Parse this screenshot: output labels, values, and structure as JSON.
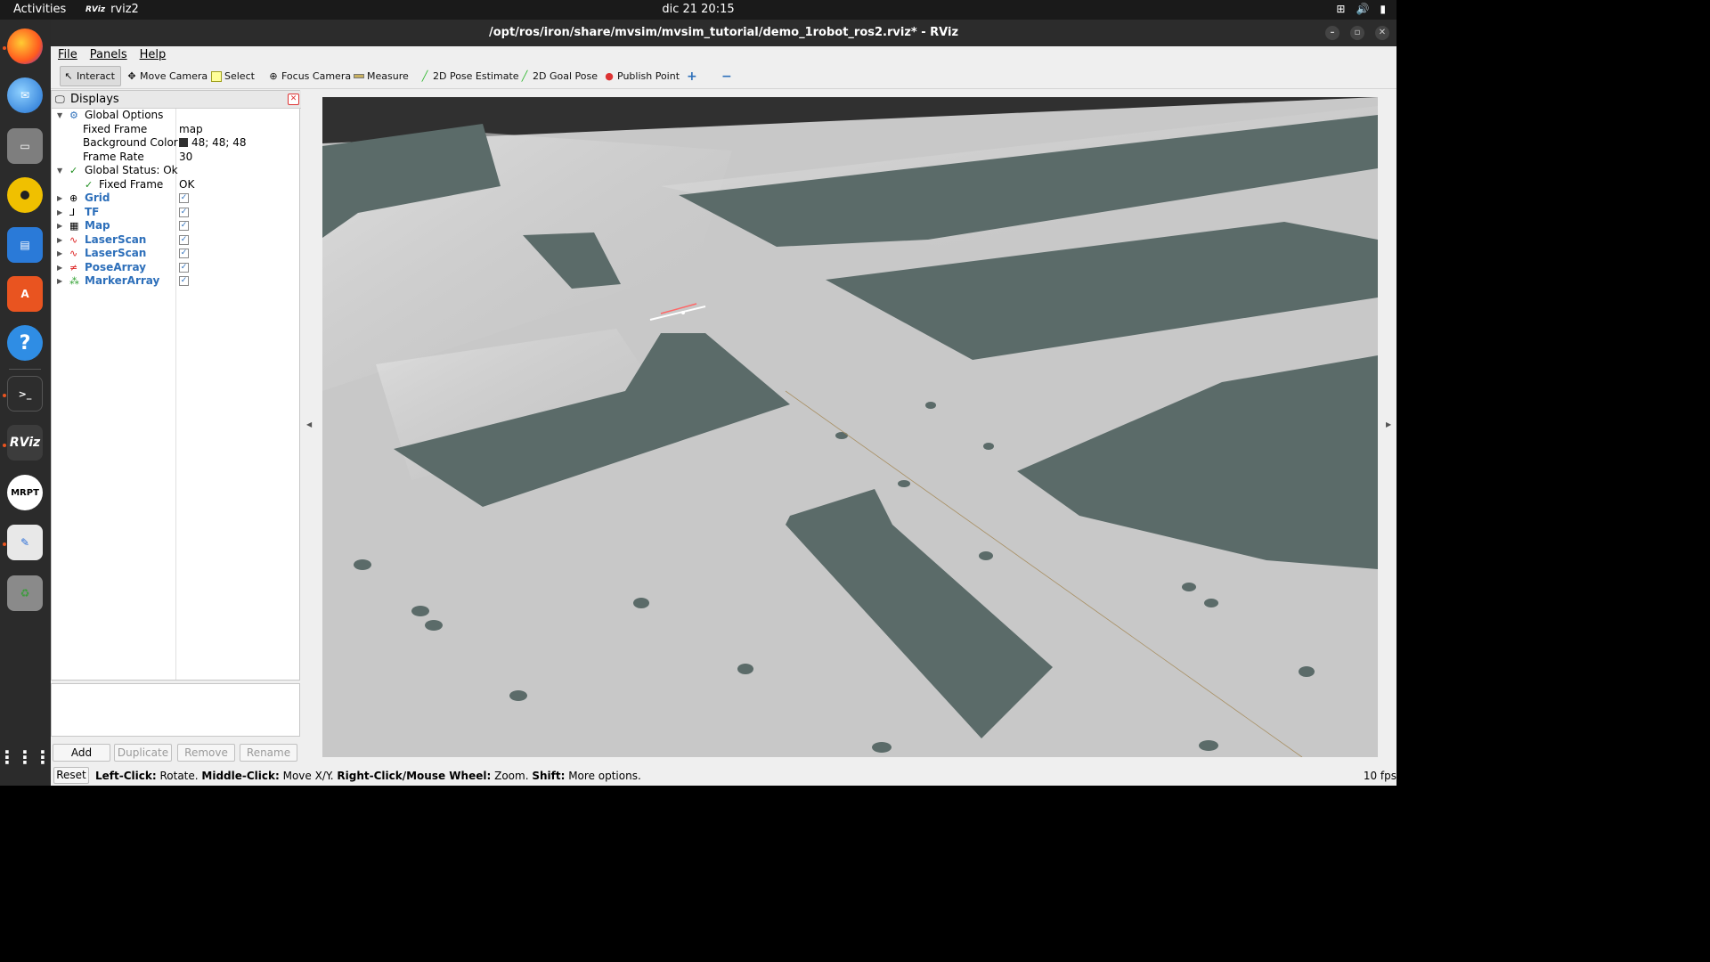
{
  "topbar": {
    "activities": "Activities",
    "app_name": "rviz2",
    "app_logo": "RViz",
    "clock": "dic 21  20:15",
    "tray_icons": [
      "network-icon",
      "volume-icon",
      "battery-icon"
    ]
  },
  "dock": {
    "items": [
      "firefox-icon",
      "thunderbird-icon",
      "files-icon",
      "rhythmbox-icon",
      "writer-icon",
      "app-center-icon",
      "help-icon",
      "terminal-icon",
      "rviz-icon",
      "mrpt-icon",
      "text-editor-icon",
      "trash-icon",
      "app-grid-icon"
    ],
    "rviz_label": "RViz",
    "mrpt_label": "MRPT"
  },
  "window": {
    "title": "/opt/ros/iron/share/mvsim/mvsim_tutorial/demo_1robot_ros2.rviz* - RViz"
  },
  "menu": [
    "File",
    "Panels",
    "Help"
  ],
  "toolbar": [
    {
      "label": "Interact",
      "icon": "cursor-icon",
      "active": true
    },
    {
      "label": "Move Camera",
      "icon": "move-camera-icon"
    },
    {
      "label": "Select",
      "icon": "select-icon"
    },
    {
      "label": "Focus Camera",
      "icon": "focus-camera-icon"
    },
    {
      "label": "Measure",
      "icon": "measure-icon"
    },
    {
      "label": "2D Pose Estimate",
      "icon": "pose-estimate-icon"
    },
    {
      "label": "2D Goal Pose",
      "icon": "goal-pose-icon"
    },
    {
      "label": "Publish Point",
      "icon": "publish-point-icon"
    }
  ],
  "displays": {
    "header": "Displays",
    "global_options": {
      "label": "Global Options",
      "fixed_frame_label": "Fixed Frame",
      "fixed_frame_value": "map",
      "background_color_label": "Background Color",
      "background_color_value": "48; 48; 48",
      "frame_rate_label": "Frame Rate",
      "frame_rate_value": "30"
    },
    "global_status": {
      "label": "Global Status: Ok",
      "fixed_frame_label": "Fixed Frame",
      "fixed_frame_value": "OK"
    },
    "items": [
      {
        "label": "Grid",
        "checked": true
      },
      {
        "label": "TF",
        "checked": true
      },
      {
        "label": "Map",
        "checked": true
      },
      {
        "label": "LaserScan",
        "checked": true
      },
      {
        "label": "LaserScan",
        "checked": true
      },
      {
        "label": "PoseArray",
        "checked": true
      },
      {
        "label": "MarkerArray",
        "checked": true
      }
    ],
    "buttons": {
      "add": "Add",
      "duplicate": "Duplicate",
      "remove": "Remove",
      "rename": "Rename"
    }
  },
  "statusbar": {
    "reset": "Reset",
    "hint_parts": [
      {
        "bold": "Left-Click:",
        "text": " Rotate. "
      },
      {
        "bold": "Middle-Click:",
        "text": " Move X/Y. "
      },
      {
        "bold": "Right-Click/Mouse Wheel:",
        "text": " Zoom. "
      },
      {
        "bold": "Shift:",
        "text": " More options."
      }
    ],
    "fps": "10 fps"
  },
  "colors": {
    "map_free": "#c9c9c9",
    "map_occupied": "#5b6b69",
    "background": "#303030",
    "accent_blue": "#2d6fba"
  }
}
